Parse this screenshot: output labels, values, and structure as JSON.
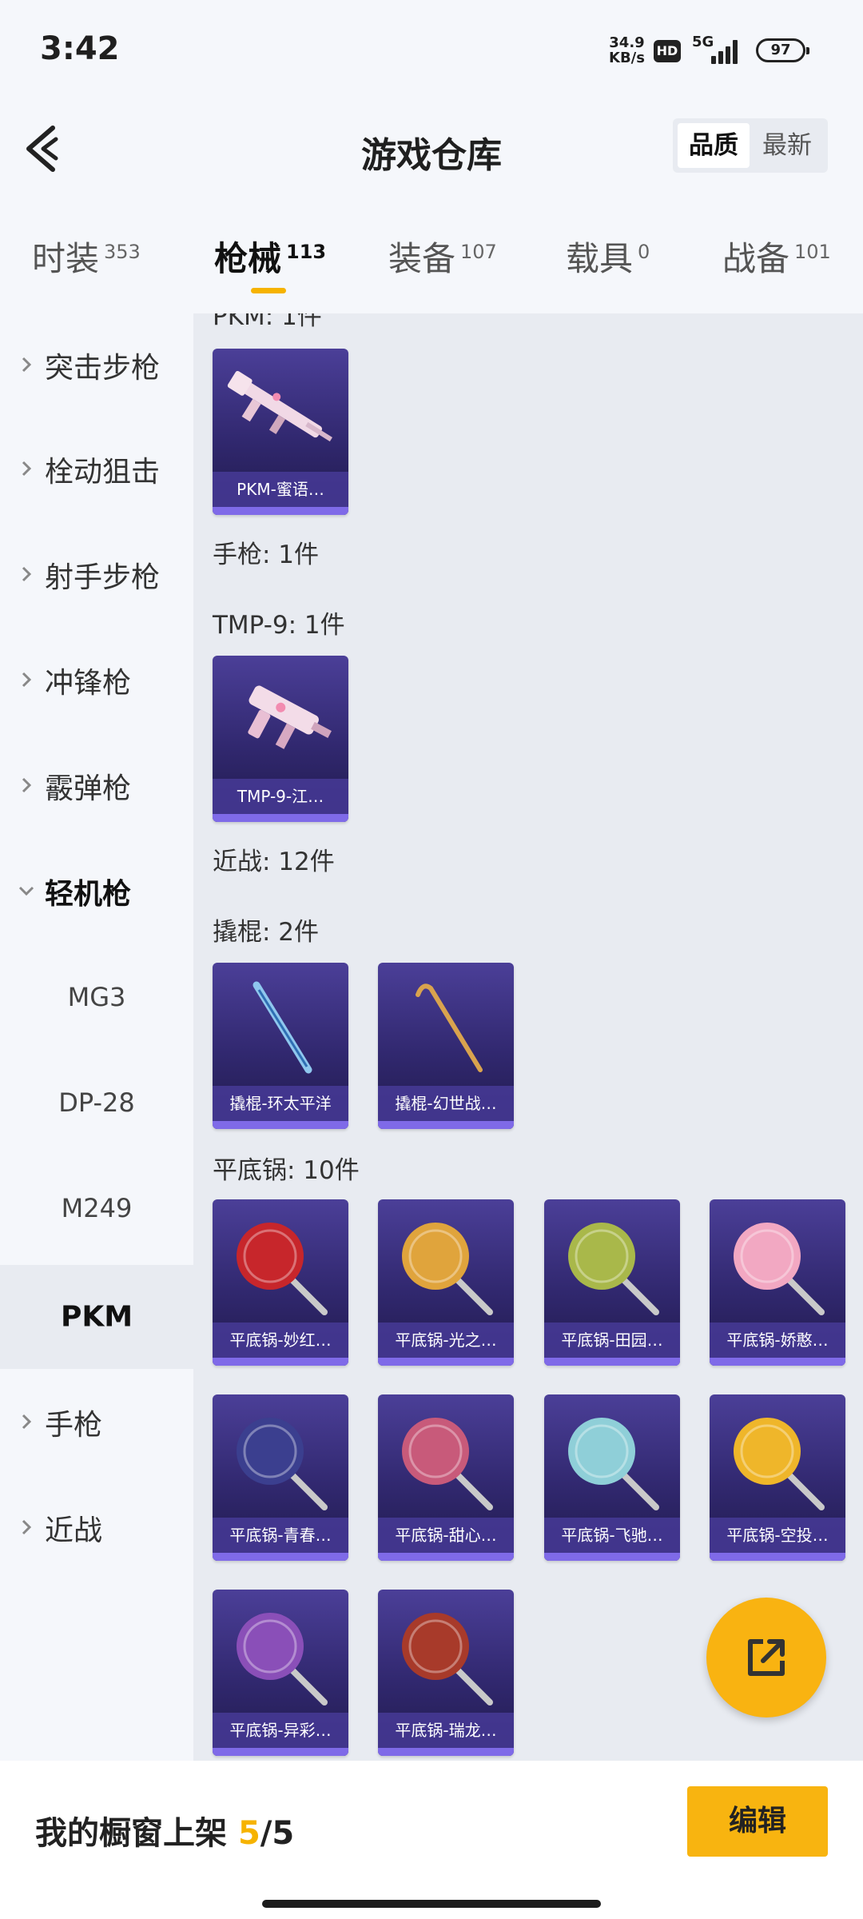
{
  "status_bar": {
    "time": "3:42",
    "net_speed_value": "34.9",
    "net_speed_unit": "KB/s",
    "hd": "HD",
    "network": "5G",
    "battery": "97"
  },
  "header": {
    "title": "游戏仓库",
    "sort_quality": "品质",
    "sort_latest": "最新"
  },
  "tabs": [
    {
      "label": "时装",
      "count": "353"
    },
    {
      "label": "枪械",
      "count": "113"
    },
    {
      "label": "装备",
      "count": "107"
    },
    {
      "label": "载具",
      "count": "0"
    },
    {
      "label": "战备",
      "count": "101"
    }
  ],
  "sidebar": {
    "items": [
      {
        "label": "突击步枪"
      },
      {
        "label": "栓动狙击"
      },
      {
        "label": "射手步枪"
      },
      {
        "label": "冲锋枪"
      },
      {
        "label": "霰弹枪"
      },
      {
        "label": "轻机枪"
      },
      {
        "label": "MG3"
      },
      {
        "label": "DP-28"
      },
      {
        "label": "M249"
      },
      {
        "label": "PKM"
      },
      {
        "label": "手枪"
      },
      {
        "label": "近战"
      }
    ]
  },
  "content": {
    "sections": [
      {
        "title": "PKM: 1件"
      },
      {
        "title": "手枪: 1件"
      },
      {
        "title": "TMP-9: 1件"
      },
      {
        "title": "近战: 12件"
      },
      {
        "title": "撬棍: 2件"
      },
      {
        "title": "平底锅: 10件"
      }
    ],
    "items": [
      {
        "name": "PKM-蜜语…"
      },
      {
        "name": "TMP-9-江…"
      },
      {
        "name": "撬棍-环太平洋"
      },
      {
        "name": "撬棍-幻世战…"
      },
      {
        "name": "平底锅-妙红…",
        "color": "#c7262b"
      },
      {
        "name": "平底锅-光之…",
        "color": "#e0a43c"
      },
      {
        "name": "平底锅-田园…",
        "color": "#a9b84a"
      },
      {
        "name": "平底锅-娇憨…",
        "color": "#f2a8c2"
      },
      {
        "name": "平底锅-青春…",
        "color": "#3b3f8f"
      },
      {
        "name": "平底锅-甜心…",
        "color": "#c85a7a"
      },
      {
        "name": "平底锅-飞驰…",
        "color": "#8fcfd8"
      },
      {
        "name": "平底锅-空投…",
        "color": "#efb62a"
      },
      {
        "name": "平底锅-异彩…",
        "color": "#8a4fb8"
      },
      {
        "name": "平底锅-瑞龙…",
        "color": "#a83a2a"
      }
    ]
  },
  "bottom_bar": {
    "label_prefix": "我的橱窗上架",
    "current": "5",
    "separator": "/",
    "total": "5",
    "edit_label": "编辑"
  },
  "colors": {
    "accent": "#f6b300",
    "card_bg": "#31286f",
    "content_bg": "#e8ebf1"
  }
}
